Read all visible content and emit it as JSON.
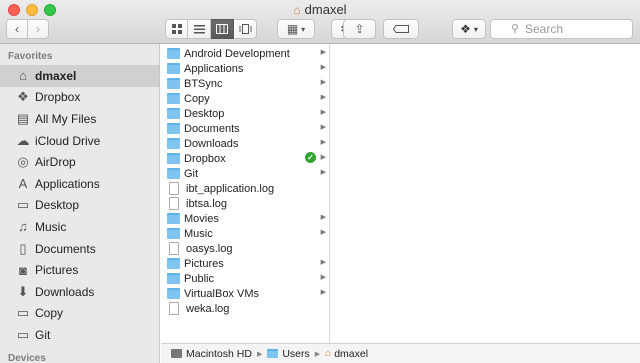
{
  "window": {
    "title": "dmaxel"
  },
  "toolbar": {
    "back_icon": "chevron-left-icon",
    "forward_icon": "chevron-right-icon",
    "views": [
      "icon-view",
      "list-view",
      "column-view",
      "coverflow-view"
    ],
    "active_view": "column-view",
    "search_placeholder": "Search"
  },
  "sidebar": {
    "section_favorites": "Favorites",
    "items": [
      {
        "label": "dmaxel",
        "icon": "home-icon",
        "selected": true
      },
      {
        "label": "Dropbox",
        "icon": "dropbox-icon"
      },
      {
        "label": "All My Files",
        "icon": "all-files-icon"
      },
      {
        "label": "iCloud Drive",
        "icon": "cloud-icon"
      },
      {
        "label": "AirDrop",
        "icon": "airdrop-icon"
      },
      {
        "label": "Applications",
        "icon": "applications-icon"
      },
      {
        "label": "Desktop",
        "icon": "desktop-icon"
      },
      {
        "label": "Music",
        "icon": "music-icon"
      },
      {
        "label": "Documents",
        "icon": "documents-icon"
      },
      {
        "label": "Pictures",
        "icon": "camera-icon"
      },
      {
        "label": "Downloads",
        "icon": "download-icon"
      },
      {
        "label": "Copy",
        "icon": "folder-icon"
      },
      {
        "label": "Git",
        "icon": "folder-icon"
      }
    ],
    "section_devices": "Devices"
  },
  "column1": {
    "items": [
      {
        "label": "Android Development",
        "kind": "folder",
        "arrow": true
      },
      {
        "label": "Applications",
        "kind": "folder",
        "arrow": true
      },
      {
        "label": "BTSync",
        "kind": "folder",
        "arrow": true
      },
      {
        "label": "Copy",
        "kind": "folder",
        "arrow": true
      },
      {
        "label": "Desktop",
        "kind": "folder",
        "arrow": true
      },
      {
        "label": "Documents",
        "kind": "folder",
        "arrow": true
      },
      {
        "label": "Downloads",
        "kind": "folder",
        "arrow": true
      },
      {
        "label": "Dropbox",
        "kind": "folder",
        "arrow": true,
        "synced": true
      },
      {
        "label": "Git",
        "kind": "folder",
        "arrow": true
      },
      {
        "label": "ibt_application.log",
        "kind": "file",
        "arrow": false
      },
      {
        "label": "ibtsa.log",
        "kind": "file",
        "arrow": false
      },
      {
        "label": "Movies",
        "kind": "folder",
        "arrow": true
      },
      {
        "label": "Music",
        "kind": "folder",
        "arrow": true
      },
      {
        "label": "oasys.log",
        "kind": "file",
        "arrow": false
      },
      {
        "label": "Pictures",
        "kind": "folder",
        "arrow": true
      },
      {
        "label": "Public",
        "kind": "folder",
        "arrow": true
      },
      {
        "label": "VirtualBox VMs",
        "kind": "folder",
        "arrow": true
      },
      {
        "label": "weka.log",
        "kind": "file",
        "arrow": false
      }
    ]
  },
  "pathbar": {
    "segments": [
      "Macintosh HD",
      "Users",
      "dmaxel"
    ]
  }
}
